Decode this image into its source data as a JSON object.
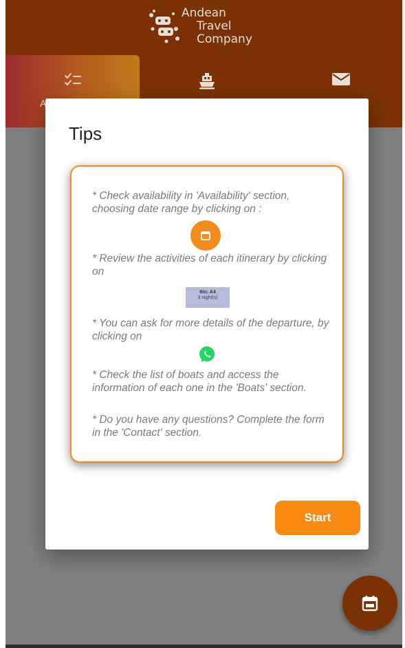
{
  "header": {
    "logo": {
      "line1": "Andean",
      "line2": "Travel",
      "line3": "Company"
    },
    "tabs": [
      {
        "icon": "checklist-icon",
        "label": "A"
      },
      {
        "icon": "ship-icon"
      },
      {
        "icon": "mail-icon"
      }
    ]
  },
  "modal": {
    "title": "Tips",
    "tips": [
      "* Check availability in 'Availability' section, choosing date range by clicking on :",
      "* Review the activities of each itinerary by clicking on",
      "* You can ask for more details of the departure, by clicking on",
      "* Check the list of boats and access the information of each one in the 'Boats' section.",
      "* Do you have any questions? Complete the form in the 'Contact' section."
    ],
    "itinerary_badge": {
      "line1": "Itin: A4",
      "line2": "3 night(s)"
    },
    "start_label": "Start"
  },
  "fab": {
    "icon": "calendar-icon"
  },
  "colors": {
    "header": "#7b3104",
    "accent": "#f28c1f",
    "start_button": "#f98a13",
    "badge": "#b6bcdb",
    "whatsapp": "#25d366",
    "overlay": "#7f7f7f"
  }
}
